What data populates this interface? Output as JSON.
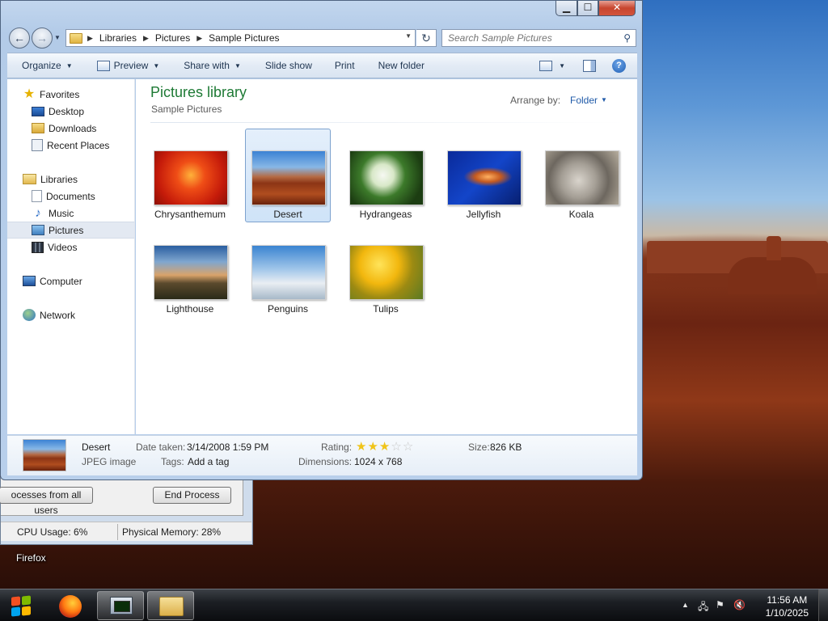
{
  "explorer": {
    "caption": {
      "minimize": "▁",
      "maximize": "☐",
      "close": "✕"
    },
    "breadcrumb": [
      "Libraries",
      "Pictures",
      "Sample Pictures"
    ],
    "search_placeholder": "Search Sample Pictures",
    "toolbar": {
      "organize": "Organize",
      "preview": "Preview",
      "share_with": "Share with",
      "slide_show": "Slide show",
      "print": "Print",
      "new_folder": "New folder"
    },
    "nav": {
      "favorites": "Favorites",
      "desktop": "Desktop",
      "downloads": "Downloads",
      "recent_places": "Recent Places",
      "libraries": "Libraries",
      "documents": "Documents",
      "music": "Music",
      "pictures": "Pictures",
      "videos": "Videos",
      "computer": "Computer",
      "network": "Network"
    },
    "content": {
      "title": "Pictures library",
      "subtitle": "Sample Pictures",
      "arrange_by_label": "Arrange by:",
      "arrange_by_value": "Folder",
      "files": [
        {
          "name": "Chrysanthemum"
        },
        {
          "name": "Desert"
        },
        {
          "name": "Hydrangeas"
        },
        {
          "name": "Jellyfish"
        },
        {
          "name": "Koala"
        },
        {
          "name": "Lighthouse"
        },
        {
          "name": "Penguins"
        },
        {
          "name": "Tulips"
        }
      ]
    },
    "details": {
      "name": "Desert",
      "type": "JPEG image",
      "date_taken_label": "Date taken:",
      "date_taken": "3/14/2008 1:59 PM",
      "tags_label": "Tags:",
      "tags": "Add a tag",
      "rating_label": "Rating:",
      "rating": 3,
      "rating_max": 5,
      "dimensions_label": "Dimensions:",
      "dimensions": "1024 x 768",
      "size_label": "Size:",
      "size": "826 KB"
    }
  },
  "task_manager": {
    "show_processes_button": "ocesses from all users",
    "end_process_button": "End Process",
    "cpu_usage": "CPU Usage: 6%",
    "physical_memory": "Physical Memory: 28%"
  },
  "desktop": {
    "firefox_label": "Firefox"
  },
  "taskbar": {
    "clock_time": "11:56 AM",
    "clock_date": "1/10/2025"
  }
}
